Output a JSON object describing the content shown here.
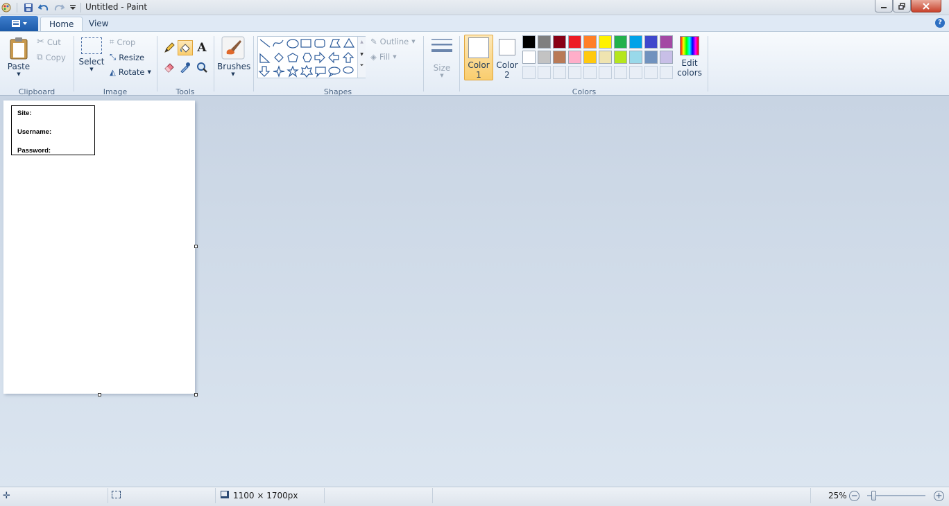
{
  "window": {
    "title": "Untitled - Paint"
  },
  "tabs": [
    {
      "label": "Home"
    },
    {
      "label": "View"
    }
  ],
  "clipboard": {
    "paste": "Paste",
    "cut": "Cut",
    "copy": "Copy",
    "group": "Clipboard"
  },
  "image": {
    "select": "Select",
    "crop": "Crop",
    "resize": "Resize",
    "rotate": "Rotate",
    "group": "Image"
  },
  "tools": {
    "group": "Tools",
    "selected_tool": "fill-icon"
  },
  "brushes": {
    "label": "Brushes"
  },
  "shapes": {
    "group": "Shapes",
    "outline": "Outline",
    "fill": "Fill"
  },
  "size": {
    "label": "Size"
  },
  "colors": {
    "group": "Colors",
    "color1_line1": "Color",
    "color1_line2": "1",
    "color2_line1": "Color",
    "color2_line2": "2",
    "edit_line1": "Edit",
    "edit_line2": "colors",
    "color1": "#ffffff",
    "color2": "#ffffff",
    "palette_row1": [
      "#000000",
      "#7f7f7f",
      "#880015",
      "#ed1c24",
      "#ff7f27",
      "#fff200",
      "#22b14c",
      "#00a2e8",
      "#3f48cc",
      "#a349a4"
    ],
    "palette_row2": [
      "#ffffff",
      "#c3c3c3",
      "#b97a57",
      "#ffaec9",
      "#ffc90e",
      "#efe4b0",
      "#b5e61d",
      "#99d9ea",
      "#7092be",
      "#c8bfe7"
    ]
  },
  "document": {
    "fields": [
      "Site:",
      "Username:",
      "Password:"
    ]
  },
  "status": {
    "dimensions": "1100 × 1700px",
    "zoom": "25%"
  }
}
